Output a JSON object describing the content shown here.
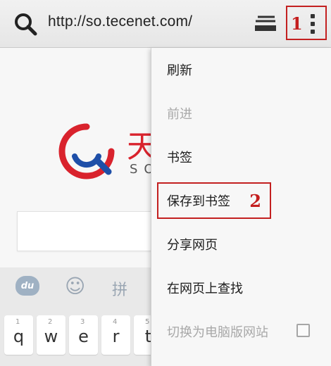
{
  "toolbar": {
    "url": "http://so.tecenet.com/",
    "search_icon": "search-icon",
    "tabs_icon": "tabs-icon",
    "menu_icon": "more-vertical-icon",
    "marker_1": "1"
  },
  "page": {
    "logo_text": "天",
    "logo_sub": "SO",
    "keyboard": {
      "tools": [
        "du",
        "☺",
        "拼"
      ],
      "keys": [
        {
          "num": "1",
          "ch": "q"
        },
        {
          "num": "2",
          "ch": "w"
        },
        {
          "num": "3",
          "ch": "e"
        },
        {
          "num": "4",
          "ch": "r"
        },
        {
          "num": "5",
          "ch": "t"
        }
      ]
    }
  },
  "menu": {
    "items": [
      {
        "label": "刷新"
      },
      {
        "label": "前进"
      },
      {
        "label": "书签"
      },
      {
        "label": "保存到书签"
      },
      {
        "label": "分享网页"
      },
      {
        "label": "在网页上查找"
      },
      {
        "label": "切换为电脑版网站"
      }
    ],
    "marker_2": "2"
  },
  "colors": {
    "highlight": "#c32020",
    "logo_red": "#d9232d",
    "logo_blue": "#1e4fa8"
  }
}
